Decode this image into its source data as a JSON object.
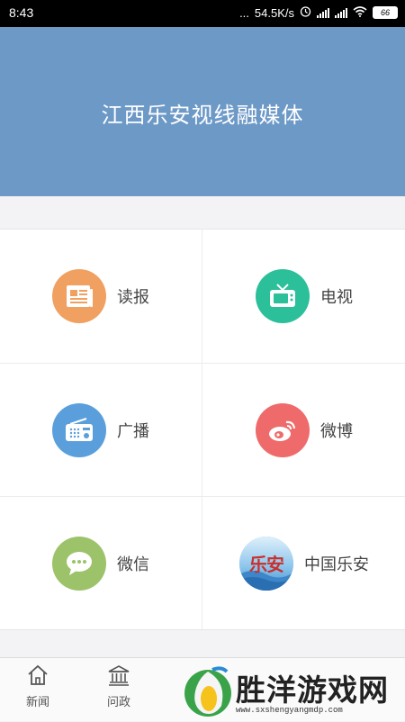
{
  "status_bar": {
    "time": "8:43",
    "dots": "...",
    "speed": "54.5K/s",
    "battery": "66"
  },
  "header": {
    "title": "江西乐安视线融媒体"
  },
  "grid": {
    "items": [
      {
        "label": "读报",
        "icon": "newspaper-icon",
        "color": "#f0a060"
      },
      {
        "label": "电视",
        "icon": "tv-icon",
        "color": "#2bbf9a"
      },
      {
        "label": "广播",
        "icon": "radio-icon",
        "color": "#5a9fdc"
      },
      {
        "label": "微博",
        "icon": "weibo-icon",
        "color": "#ef6a6a"
      },
      {
        "label": "微信",
        "icon": "wechat-icon",
        "color": "#9cc36a"
      },
      {
        "label": "中国乐安",
        "icon": "lean-logo",
        "logo_text": "乐安"
      }
    ]
  },
  "tabbar": {
    "tabs": [
      {
        "label": "新闻",
        "icon": "home-icon"
      },
      {
        "label": "问政",
        "icon": "government-building-icon"
      }
    ]
  },
  "watermark": {
    "text": "胜洋游戏网",
    "url": "www.sxshengyangmdp.com"
  }
}
